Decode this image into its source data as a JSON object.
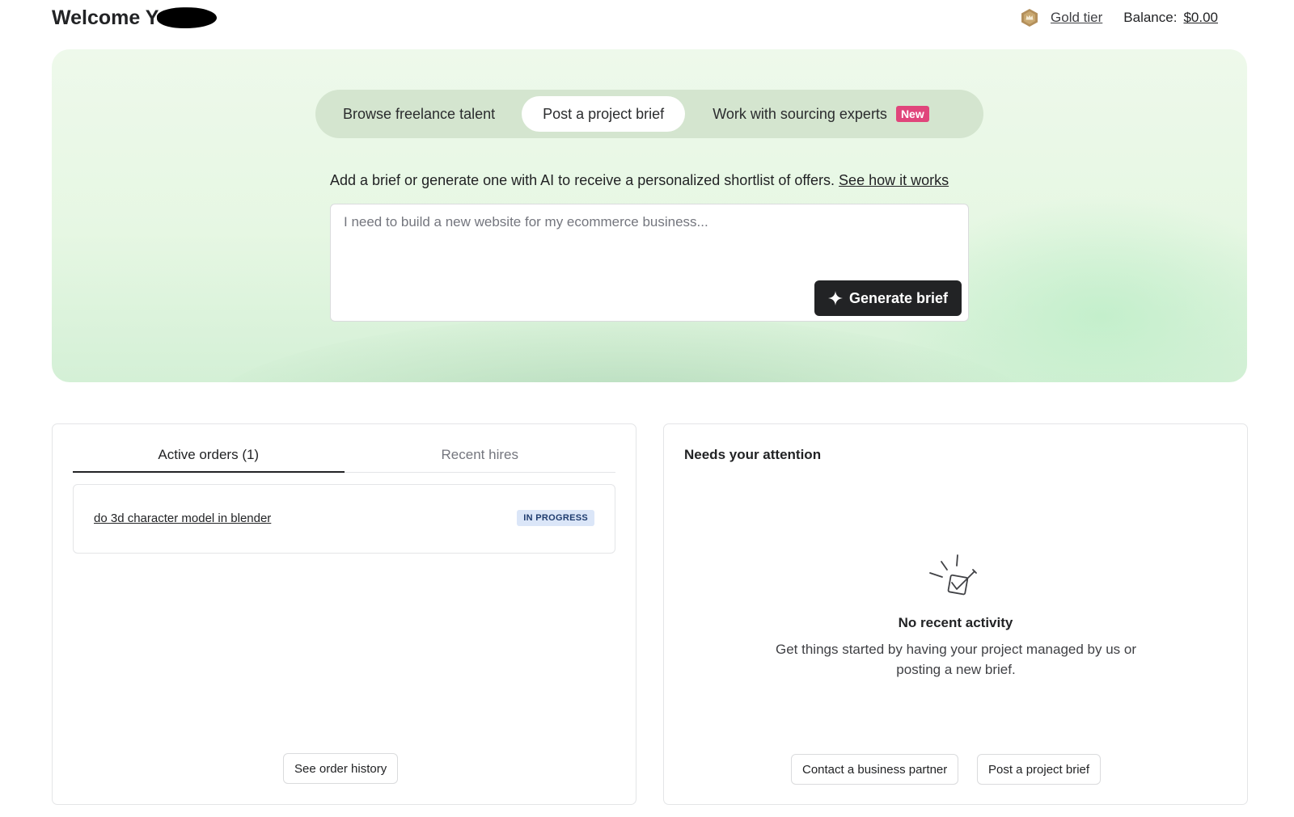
{
  "header": {
    "welcome": "Welcome Y",
    "tier_label": "Gold tier",
    "balance_label": "Balance:",
    "balance_value": "$0.00"
  },
  "hero": {
    "tabs": [
      {
        "label": "Browse freelance talent"
      },
      {
        "label": "Post a project brief"
      },
      {
        "label": "Work with sourcing experts",
        "badge": "New"
      }
    ],
    "description": "Add a brief or generate one with AI to receive a personalized shortlist of offers.",
    "how_link": "See how it works",
    "brief_placeholder": "I need to build a new website for my ecommerce business...",
    "generate_label": "Generate brief"
  },
  "orders": {
    "tabs": [
      {
        "label": "Active orders (1)"
      },
      {
        "label": "Recent hires"
      }
    ],
    "items": [
      {
        "title": "do 3d character model in blender",
        "status": "IN PROGRESS"
      }
    ],
    "history_label": "See order history"
  },
  "attention": {
    "title": "Needs your attention",
    "empty_title": "No recent activity",
    "empty_desc": "Get things started by having your project managed by us or posting a new brief.",
    "contact_label": "Contact a business partner",
    "post_label": "Post a project brief"
  },
  "icons": {
    "tier": "gold-tier-icon",
    "generate": "sparkle-icon",
    "empty": "checklist-burst-icon"
  },
  "colors": {
    "new_badge": "#e0457b",
    "status_badge_bg": "#dbe6f8",
    "primary_button": "#222325",
    "hero_bg": "#e6f7e3",
    "segmented_bg": "#d4e5cf",
    "tier_gold": "#b38f5b"
  }
}
